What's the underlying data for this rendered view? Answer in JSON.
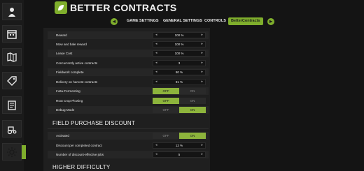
{
  "header": {
    "title": "BETTER CONTRACTS"
  },
  "tabs": {
    "prev": "◂",
    "next": "▸",
    "items": [
      {
        "label": "GAME SETTINGS"
      },
      {
        "label": "GENERAL SETTINGS"
      },
      {
        "label": "CONTROLS"
      },
      {
        "label": "BetterContracts"
      }
    ]
  },
  "sidebar": {
    "items": [
      {
        "icon": "farmer-icon"
      },
      {
        "icon": "calendar-icon"
      },
      {
        "icon": "map-icon"
      },
      {
        "icon": "price-tag-icon"
      },
      {
        "icon": "contracts-icon"
      },
      {
        "icon": "tractor-icon"
      },
      {
        "icon": "statistics-icon"
      },
      {
        "icon": "settings-icon",
        "active": true
      }
    ]
  },
  "settings": [
    {
      "label": "Reward",
      "value": "100 %"
    },
    {
      "label": "Mow and bale reward",
      "value": "100 %"
    },
    {
      "label": "Lease Cost",
      "value": "100 %"
    },
    {
      "label": "Concurrently active contracts",
      "value": "3"
    },
    {
      "label": "Fieldwork complete",
      "value": "80 %"
    },
    {
      "label": "Delivery on harvest contracts",
      "value": "91 %"
    },
    {
      "label": "Insta-Fermenting",
      "off": "OFF",
      "on": "ON",
      "state": "off"
    },
    {
      "label": "Root Crop Plowing",
      "off": "OFF",
      "on": "ON",
      "state": "off"
    },
    {
      "label": "Debug Mode",
      "off": "OFF",
      "on": "ON",
      "state": "on"
    }
  ],
  "field_purchase": {
    "title": "FIELD PURCHASE DISCOUNT",
    "rows": [
      {
        "label": "Activated",
        "off": "OFF",
        "on": "ON",
        "state": "on"
      },
      {
        "label": "Discount per completed contract",
        "value": "12 %"
      },
      {
        "label": "Number of discount-effective jobs",
        "value": "5"
      }
    ]
  },
  "higher_difficulty": {
    "title": "HIGHER DIFFICULTY"
  },
  "arrows": {
    "left": "◂",
    "right": "▸"
  },
  "colors": {
    "accent": "#7fae2c",
    "background": "#141414",
    "panel": "#1f1f1f"
  }
}
